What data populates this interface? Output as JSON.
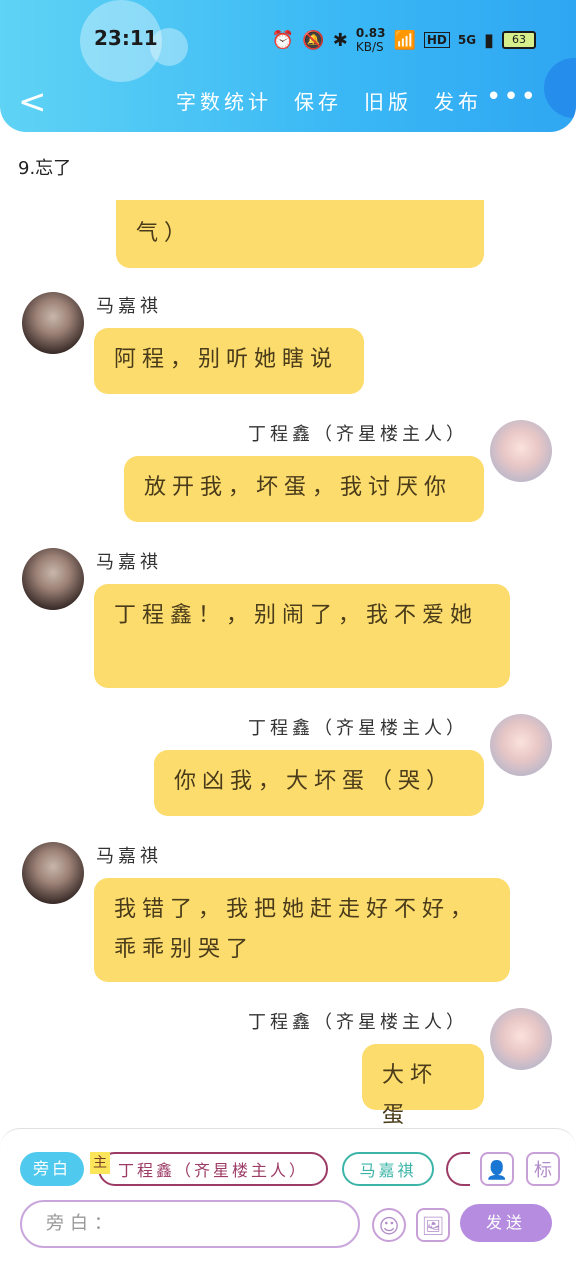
{
  "status": {
    "time": "23:11",
    "speed": "0.83",
    "speed_unit": "KB/S",
    "hd": "HD",
    "network": "5G",
    "battery": "63"
  },
  "toolbar": {
    "back": "<",
    "actions": [
      "字数统计",
      "保存",
      "旧版",
      "发布"
    ],
    "more": "•••"
  },
  "chapter": "9.忘了",
  "messages": [
    {
      "side": "right",
      "speaker": "",
      "text": "气）"
    },
    {
      "side": "left",
      "speaker": "马嘉祺",
      "text": "阿程，别听她瞎说"
    },
    {
      "side": "right",
      "speaker": "丁程鑫（齐星楼主人）",
      "text": "放开我，坏蛋，我讨厌你"
    },
    {
      "side": "left",
      "speaker": "马嘉祺",
      "text": "丁程鑫！，别闹了，我不爱她"
    },
    {
      "side": "right",
      "speaker": "丁程鑫（齐星楼主人）",
      "text": "你凶我，大坏蛋（哭）"
    },
    {
      "side": "left",
      "speaker": "马嘉祺",
      "text": "我错了，我把她赶走好不好，乖乖别哭了"
    },
    {
      "side": "right",
      "speaker": "丁程鑫（齐星楼主人）",
      "text": "大坏蛋"
    }
  ],
  "bottom": {
    "chips": [
      "旁白",
      "丁程鑫（齐星楼主人）",
      "马嘉祺"
    ],
    "main_tag": "主",
    "tag_btn": "标",
    "input_placeholder": "旁白：",
    "send": "发送"
  },
  "colors": {
    "header": "#3ab8f5",
    "bubble": "#fcdc6d",
    "send": "#b58ce0"
  }
}
